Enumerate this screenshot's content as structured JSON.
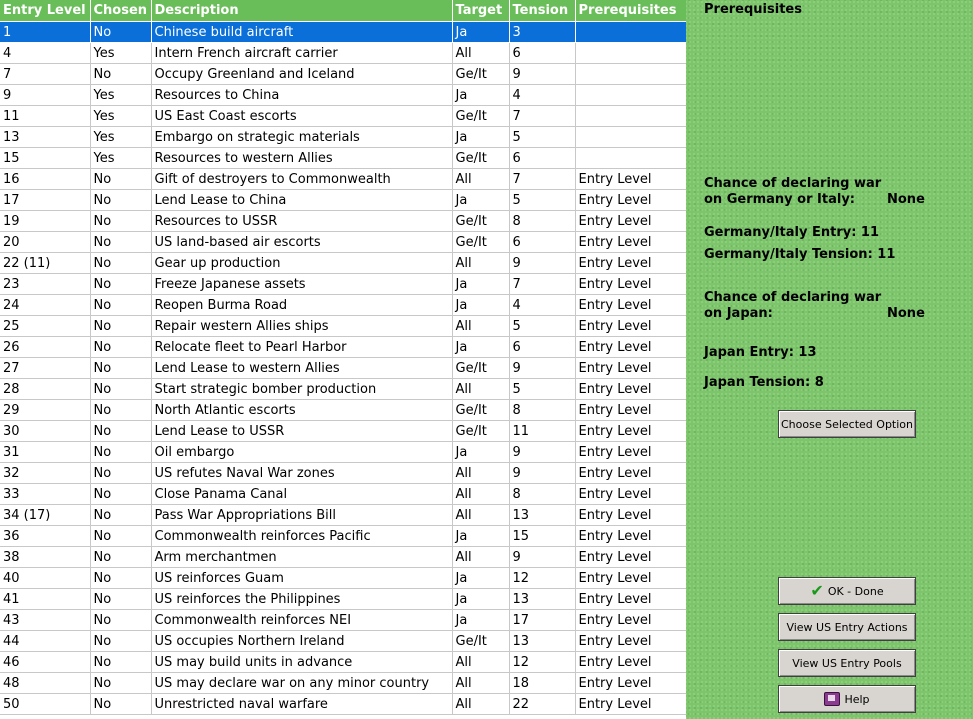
{
  "table": {
    "columns": [
      "Entry Level",
      "Chosen",
      "Description",
      "Target",
      "Tension",
      "Prerequisites"
    ],
    "rows": [
      {
        "entry": "1",
        "chosen": "No",
        "description": "Chinese build aircraft",
        "target": "Ja",
        "tension": "3",
        "prereq": ""
      },
      {
        "entry": "4",
        "chosen": "Yes",
        "description": "Intern French aircraft carrier",
        "target": "All",
        "tension": "6",
        "prereq": ""
      },
      {
        "entry": "7",
        "chosen": "No",
        "description": "Occupy Greenland and Iceland",
        "target": "Ge/It",
        "tension": "9",
        "prereq": ""
      },
      {
        "entry": "9",
        "chosen": "Yes",
        "description": "Resources to China",
        "target": "Ja",
        "tension": "4",
        "prereq": ""
      },
      {
        "entry": "11",
        "chosen": "Yes",
        "description": "US East Coast escorts",
        "target": "Ge/It",
        "tension": "7",
        "prereq": ""
      },
      {
        "entry": "13",
        "chosen": "Yes",
        "description": "Embargo on strategic materials",
        "target": "Ja",
        "tension": "5",
        "prereq": ""
      },
      {
        "entry": "15",
        "chosen": "Yes",
        "description": "Resources to western Allies",
        "target": "Ge/It",
        "tension": "6",
        "prereq": ""
      },
      {
        "entry": "16",
        "chosen": "No",
        "description": "Gift of destroyers to Commonwealth",
        "target": "All",
        "tension": "7",
        "prereq": "Entry Level"
      },
      {
        "entry": "17",
        "chosen": "No",
        "description": "Lend Lease to China",
        "target": "Ja",
        "tension": "5",
        "prereq": "Entry Level"
      },
      {
        "entry": "19",
        "chosen": "No",
        "description": "Resources to USSR",
        "target": "Ge/It",
        "tension": "8",
        "prereq": "Entry Level"
      },
      {
        "entry": "20",
        "chosen": "No",
        "description": "US land-based air escorts",
        "target": "Ge/It",
        "tension": "6",
        "prereq": "Entry Level"
      },
      {
        "entry": "22 (11)",
        "chosen": "No",
        "description": "Gear up production",
        "target": "All",
        "tension": "9",
        "prereq": "Entry Level"
      },
      {
        "entry": "23",
        "chosen": "No",
        "description": "Freeze Japanese assets",
        "target": "Ja",
        "tension": "7",
        "prereq": "Entry Level"
      },
      {
        "entry": "24",
        "chosen": "No",
        "description": "Reopen Burma Road",
        "target": "Ja",
        "tension": "4",
        "prereq": "Entry Level"
      },
      {
        "entry": "25",
        "chosen": "No",
        "description": "Repair western Allies ships",
        "target": "All",
        "tension": "5",
        "prereq": "Entry Level"
      },
      {
        "entry": "26",
        "chosen": "No",
        "description": "Relocate fleet to Pearl Harbor",
        "target": "Ja",
        "tension": "6",
        "prereq": "Entry Level"
      },
      {
        "entry": "27",
        "chosen": "No",
        "description": "Lend Lease to western Allies",
        "target": "Ge/It",
        "tension": "9",
        "prereq": "Entry Level"
      },
      {
        "entry": "28",
        "chosen": "No",
        "description": "Start strategic bomber production",
        "target": "All",
        "tension": "5",
        "prereq": "Entry Level"
      },
      {
        "entry": "29",
        "chosen": "No",
        "description": "North Atlantic escorts",
        "target": "Ge/It",
        "tension": "8",
        "prereq": "Entry Level"
      },
      {
        "entry": "30",
        "chosen": "No",
        "description": "Lend Lease to USSR",
        "target": "Ge/It",
        "tension": "11",
        "prereq": "Entry Level"
      },
      {
        "entry": "31",
        "chosen": "No",
        "description": "Oil embargo",
        "target": "Ja",
        "tension": "9",
        "prereq": "Entry Level"
      },
      {
        "entry": "32",
        "chosen": "No",
        "description": "US refutes Naval War zones",
        "target": "All",
        "tension": "9",
        "prereq": "Entry Level"
      },
      {
        "entry": "33",
        "chosen": "No",
        "description": "Close Panama Canal",
        "target": "All",
        "tension": "8",
        "prereq": "Entry Level"
      },
      {
        "entry": "34 (17)",
        "chosen": "No",
        "description": "Pass War Appropriations Bill",
        "target": "All",
        "tension": "13",
        "prereq": "Entry Level"
      },
      {
        "entry": "36",
        "chosen": "No",
        "description": "Commonwealth reinforces Pacific",
        "target": "Ja",
        "tension": "15",
        "prereq": "Entry Level"
      },
      {
        "entry": "38",
        "chosen": "No",
        "description": "Arm merchantmen",
        "target": "All",
        "tension": "9",
        "prereq": "Entry Level"
      },
      {
        "entry": "40",
        "chosen": "No",
        "description": "US reinforces Guam",
        "target": "Ja",
        "tension": "12",
        "prereq": "Entry Level"
      },
      {
        "entry": "41",
        "chosen": "No",
        "description": "US reinforces the Philippines",
        "target": "Ja",
        "tension": "13",
        "prereq": "Entry Level"
      },
      {
        "entry": "43",
        "chosen": "No",
        "description": "Commonwealth reinforces NEI",
        "target": "Ja",
        "tension": "17",
        "prereq": "Entry Level"
      },
      {
        "entry": "44",
        "chosen": "No",
        "description": "US occupies Northern Ireland",
        "target": "Ge/It",
        "tension": "13",
        "prereq": "Entry Level"
      },
      {
        "entry": "46",
        "chosen": "No",
        "description": "US may build units in advance",
        "target": "All",
        "tension": "12",
        "prereq": "Entry Level"
      },
      {
        "entry": "48",
        "chosen": "No",
        "description": "US may declare war on any minor country",
        "target": "All",
        "tension": "18",
        "prereq": "Entry Level"
      },
      {
        "entry": "50",
        "chosen": "No",
        "description": "Unrestricted naval warfare",
        "target": "All",
        "tension": "22",
        "prereq": "Entry Level"
      }
    ]
  },
  "side": {
    "prereq_title": "Prerequisites",
    "chance_germany_line1": "Chance of declaring war",
    "chance_germany_line2": "on Germany or Italy:",
    "chance_germany_value": "None",
    "germany_entry": "Germany/Italy Entry: 11",
    "germany_tension": "Germany/Italy Tension: 11",
    "chance_japan_line1": "Chance of declaring war",
    "chance_japan_line2": "on Japan:",
    "chance_japan_value": "None",
    "japan_entry": "Japan Entry: 13",
    "japan_tension": "Japan Tension: 8"
  },
  "buttons": {
    "choose": "Choose Selected Option",
    "ok": "OK - Done",
    "view_actions": "View US Entry Actions",
    "view_pools": "View US Entry Pools",
    "help": "Help"
  },
  "colors": {
    "header_bg": "#6abe5a",
    "selected_row": "#0a6fd8",
    "background": "#7cc56a"
  }
}
